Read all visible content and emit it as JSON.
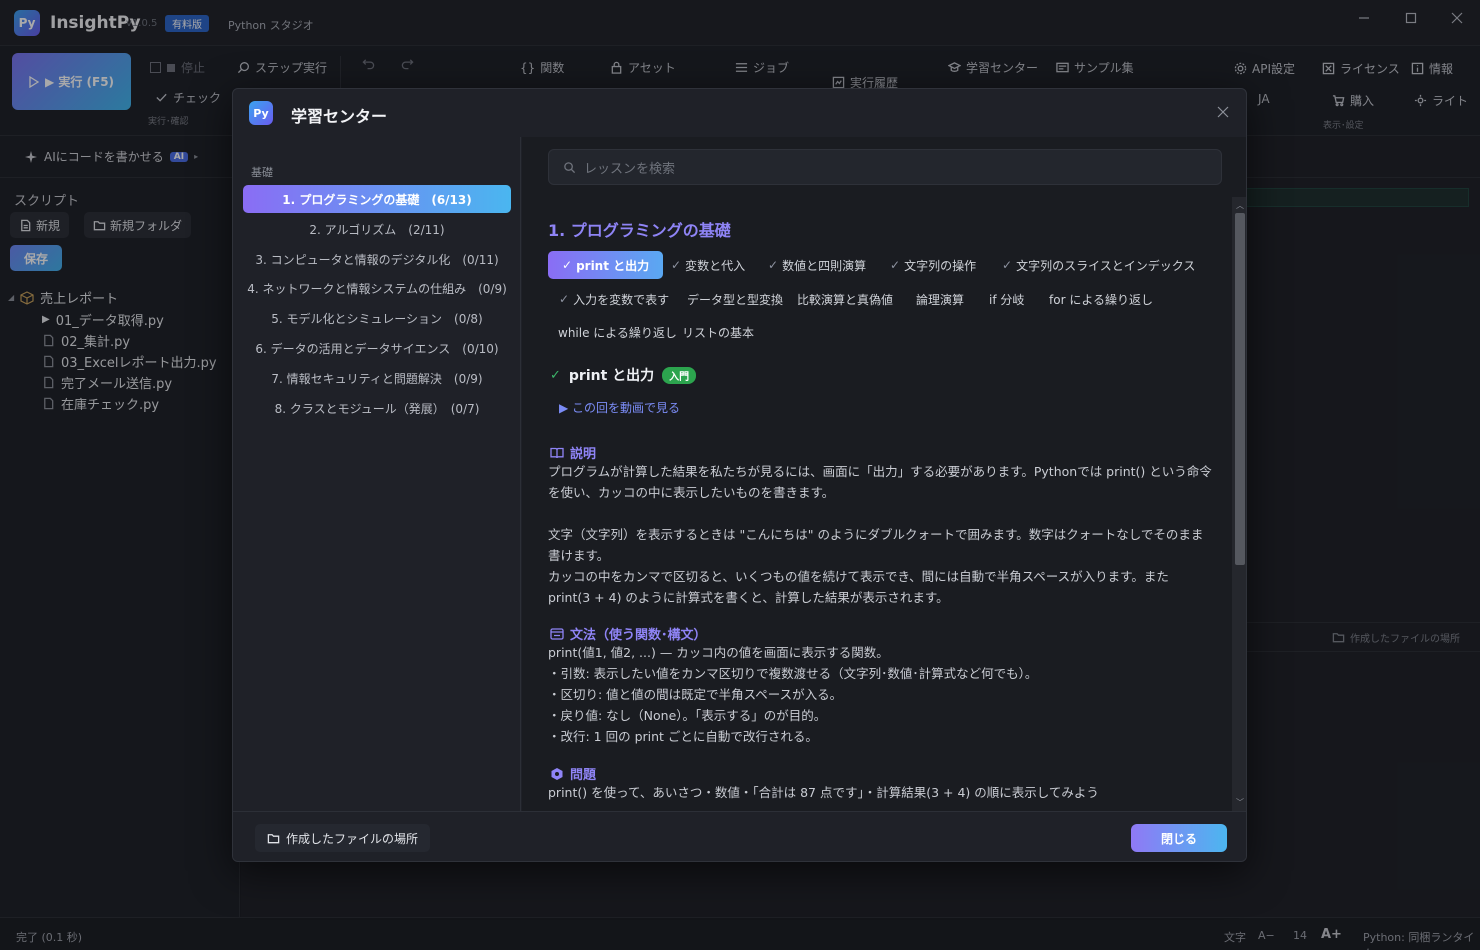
{
  "app": {
    "logo": "Py",
    "title": "InsightPy",
    "version": "v1.0.5",
    "edition_badge": "有料版",
    "subtitle": "Python スタジオ"
  },
  "toolbar": {
    "run_label": "▶ 実行 (F5)",
    "stop_label": "停止",
    "step_label": "ステップ実行",
    "check_label": "チェック",
    "run_group_caption": "実行･確認",
    "functions_label": "関数",
    "assets_label": "アセット",
    "jobs_label": "ジョブ",
    "history_label": "実行履歴",
    "learning_label": "学習センター",
    "samples_label": "サンプル集",
    "api_label": "API設定",
    "license_label": "ライセンス",
    "info_label": "情報",
    "lang_label": "JA",
    "buy_label": "購入",
    "theme_label": "ライト",
    "display_caption": "表示･設定"
  },
  "sidebar": {
    "ai_label": "AIにコードを書かせる",
    "ai_tag": "AI",
    "scripts_title": "スクリプト",
    "new_label": "新規",
    "new_folder_label": "新規フォルダ",
    "save_label": "保存",
    "folder_name": "売上レポート",
    "files": [
      "01_データ取得.py",
      "02_集計.py",
      "03_Excelレポート出力.py",
      "完了メール送信.py",
      "在庫チェック.py"
    ]
  },
  "editor": {
    "files_location_label": "作成したファイルの場所"
  },
  "status": {
    "left": "完了 (0.1 秒)",
    "font_label": "文字",
    "font_minus": "A−",
    "font_size": "14",
    "font_plus": "A+",
    "runtime": "Python: 同梱ランタイム"
  },
  "dialog": {
    "logo": "Py",
    "title": "学習センター",
    "category": "基礎",
    "lessons": [
      "1. プログラミングの基礎　(6/13)",
      "2. アルゴリズム　(2/11)",
      "3. コンピュータと情報のデジタル化　(0/11)",
      "4. ネットワークと情報システムの仕組み　(0/9)",
      "5. モデル化とシミュレーション　(0/8)",
      "6. データの活用とデータサイエンス　(0/10)",
      "7. 情報セキュリティと問題解決　(0/9)",
      "8. クラスとモジュール（発展）　(0/7)"
    ],
    "search_placeholder": "レッスンを検索",
    "section_title": "1. プログラミングの基礎",
    "topics_row1": [
      "print と出力",
      "変数と代入",
      "数値と四則演算",
      "文字列の操作",
      "文字列のスライスとインデックス"
    ],
    "topics_row2": [
      "入力を変数で表す",
      "データ型と型変換",
      "比較演算と真偽値",
      "論理演算",
      "if 分岐",
      "for による繰り返し"
    ],
    "topics_row3": [
      "while による繰り返し",
      "リストの基本"
    ],
    "lesson_title": "print と出力",
    "lesson_badge": "入門",
    "video_link": "▶ この回を動画で見る",
    "explain_head": "説明",
    "explain_p1": "プログラムが計算した結果を私たちが見るには、画面に「出力」する必要があります。Pythonでは print() という命令を使い、カッコの中に表示したいものを書きます。",
    "explain_p2": "文字（文字列）を表示するときは \"こんにちは\" のようにダブルクォートで囲みます。数字はクォートなしでそのまま書けます。",
    "explain_p3": "カッコの中をカンマで区切ると、いくつもの値を続けて表示でき、間には自動で半角スペースが入ります。また print(3 + 4) のように計算式を書くと、計算した結果が表示されます。",
    "syntax_head": "文法（使う関数･構文）",
    "syntax_lines": [
      "print(値1, 値2, ...) — カッコ内の値を画面に表示する関数。",
      "・引数: 表示したい値をカンマ区切りで複数渡せる（文字列･数値･計算式など何でも）。",
      "・区切り: 値と値の間は既定で半角スペースが入る。",
      "・戻り値: なし（None）。「表示する」のが目的。",
      "・改行: 1 回の print ごとに自動で改行される。"
    ],
    "problem_head": "問題",
    "problem_text": "print() を使って、あいさつ・数値・「合計は 87 点です」・計算結果(3 + 4) の順に表示してみよう",
    "files_location_label": "作成したファイルの場所",
    "close_label": "閉じる"
  }
}
